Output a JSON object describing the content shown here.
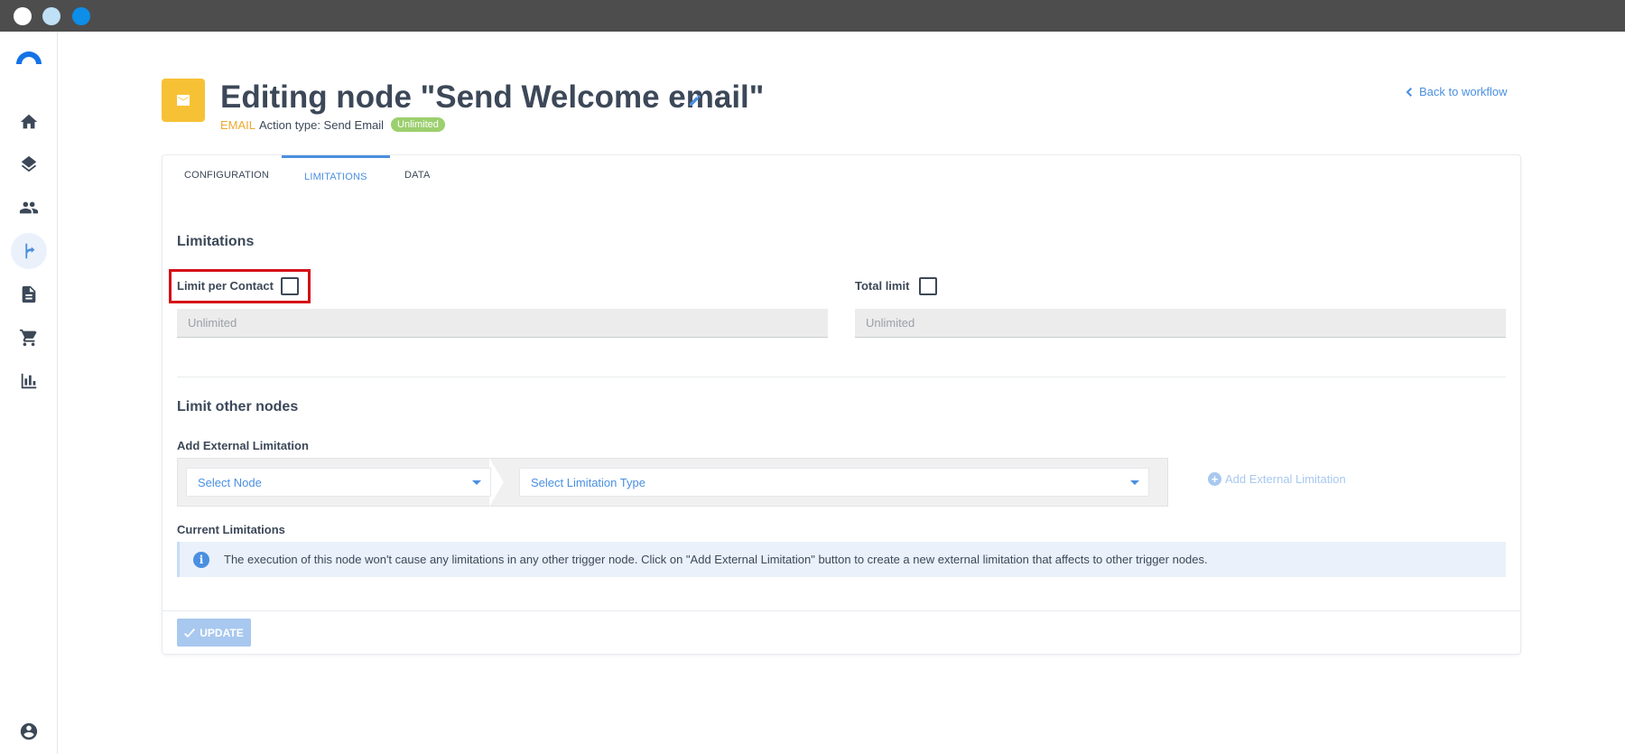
{
  "window": {
    "title_dots": [
      "close",
      "minimize",
      "maximize"
    ]
  },
  "sidebar": {
    "items": [
      {
        "icon": "home-icon"
      },
      {
        "icon": "layers-icon"
      },
      {
        "icon": "contacts-icon"
      },
      {
        "icon": "workflow-icon",
        "active": true
      },
      {
        "icon": "document-icon"
      },
      {
        "icon": "cart-icon"
      },
      {
        "icon": "analytics-icon"
      },
      {
        "icon": "account-icon"
      }
    ]
  },
  "header": {
    "title": "Editing node \"Send Welcome email\"",
    "type_tag": "EMAIL",
    "action_type": "Action type: Send Email",
    "badge": "Unlimited",
    "back_link": "Back to workflow"
  },
  "tabs": [
    {
      "label": "CONFIGURATION"
    },
    {
      "label": "LIMITATIONS",
      "active": true
    },
    {
      "label": "DATA"
    }
  ],
  "limitations": {
    "heading": "Limitations",
    "per_contact_label": "Limit per Contact",
    "per_contact_placeholder": "Unlimited",
    "total_label": "Total limit",
    "total_placeholder": "Unlimited"
  },
  "other_nodes": {
    "heading": "Limit other nodes",
    "add_label": "Add External Limitation",
    "select_node": "Select Node",
    "select_type": "Select Limitation Type",
    "add_button": "Add External Limitation",
    "current_label": "Current Limitations",
    "info_text": "The execution of this node won't cause any limitations in any other trigger node. Click on \"Add External Limitation\" button to create a new external limitation that affects to other trigger nodes."
  },
  "footer": {
    "update_label": "UPDATE"
  },
  "colors": {
    "accent": "#4a8fe0",
    "node_icon": "#f7c136",
    "badge": "#9ccf6e",
    "highlight": "#d50f16"
  }
}
